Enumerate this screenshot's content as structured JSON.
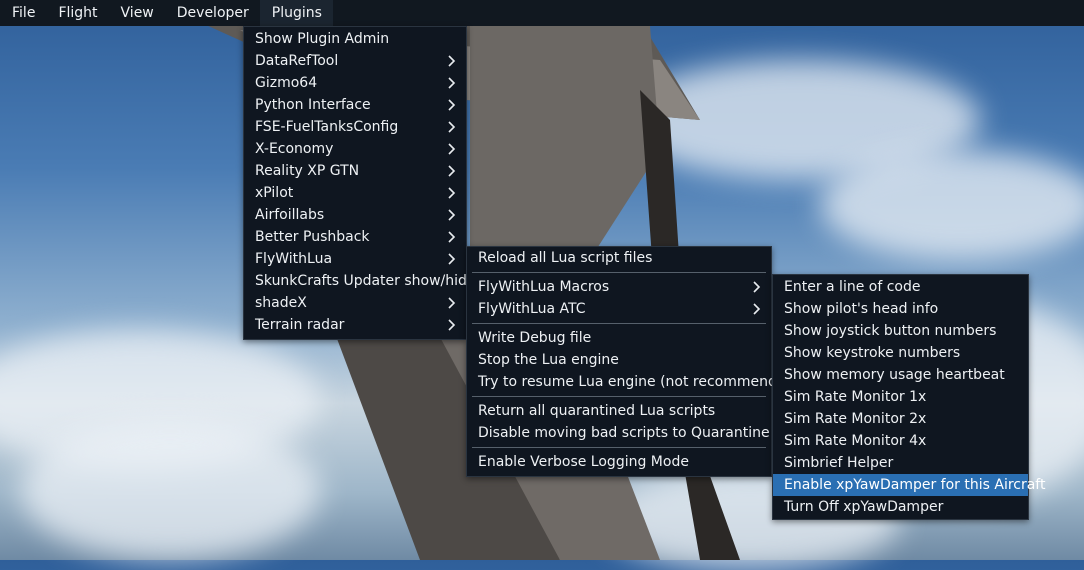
{
  "menubar": {
    "items": [
      "File",
      "Flight",
      "View",
      "Developer",
      "Plugins"
    ]
  },
  "plugins_menu": {
    "items": [
      {
        "label": "Show Plugin Admin",
        "submenu": false
      },
      {
        "label": "DataRefTool",
        "submenu": true
      },
      {
        "label": "Gizmo64",
        "submenu": true
      },
      {
        "label": "Python Interface",
        "submenu": true
      },
      {
        "label": "FSE-FuelTanksConfig",
        "submenu": true
      },
      {
        "label": "X-Economy",
        "submenu": true
      },
      {
        "label": "Reality XP GTN",
        "submenu": true
      },
      {
        "label": "xPilot",
        "submenu": true
      },
      {
        "label": "Airfoillabs",
        "submenu": true
      },
      {
        "label": "Better Pushback",
        "submenu": true
      },
      {
        "label": "FlyWithLua",
        "submenu": true
      },
      {
        "label": "SkunkCrafts Updater show/hide",
        "submenu": false
      },
      {
        "label": "shadeX",
        "submenu": true
      },
      {
        "label": "Terrain radar",
        "submenu": true
      }
    ]
  },
  "flywithlua_menu": {
    "items": [
      {
        "label": "Reload all Lua script files",
        "submenu": false
      },
      {
        "label": "FlyWithLua Macros",
        "submenu": true
      },
      {
        "label": "FlyWithLua ATC",
        "submenu": true
      },
      {
        "label": "Write Debug file",
        "submenu": false
      },
      {
        "label": "Stop the Lua engine",
        "submenu": false
      },
      {
        "label": "Try to resume Lua engine (not recommended)",
        "submenu": false
      },
      {
        "label": "Return all quarantined Lua scripts",
        "submenu": false
      },
      {
        "label": "Disable moving bad scripts to Quarantine",
        "submenu": false
      },
      {
        "label": "Enable Verbose Logging Mode",
        "submenu": false
      }
    ]
  },
  "macros_menu": {
    "items": [
      {
        "label": "Enter a line of code",
        "highlighted": false
      },
      {
        "label": "Show pilot's head info",
        "highlighted": false
      },
      {
        "label": "Show joystick button numbers",
        "highlighted": false
      },
      {
        "label": "Show keystroke numbers",
        "highlighted": false
      },
      {
        "label": "Show memory usage heartbeat",
        "highlighted": false
      },
      {
        "label": "Sim Rate Monitor 1x",
        "highlighted": false
      },
      {
        "label": "Sim Rate Monitor 2x",
        "highlighted": false
      },
      {
        "label": "Sim Rate Monitor 4x",
        "highlighted": false
      },
      {
        "label": "Simbrief Helper",
        "highlighted": false
      },
      {
        "label": "Enable xpYawDamper for this Aircraft",
        "highlighted": true
      },
      {
        "label": "Turn Off xpYawDamper",
        "highlighted": false
      }
    ]
  },
  "colors": {
    "menu_bg": "#0f1620",
    "highlight": "#2a6fb3",
    "text": "#eef1f4"
  },
  "icons": {
    "submenu": "chevron-right-icon"
  }
}
